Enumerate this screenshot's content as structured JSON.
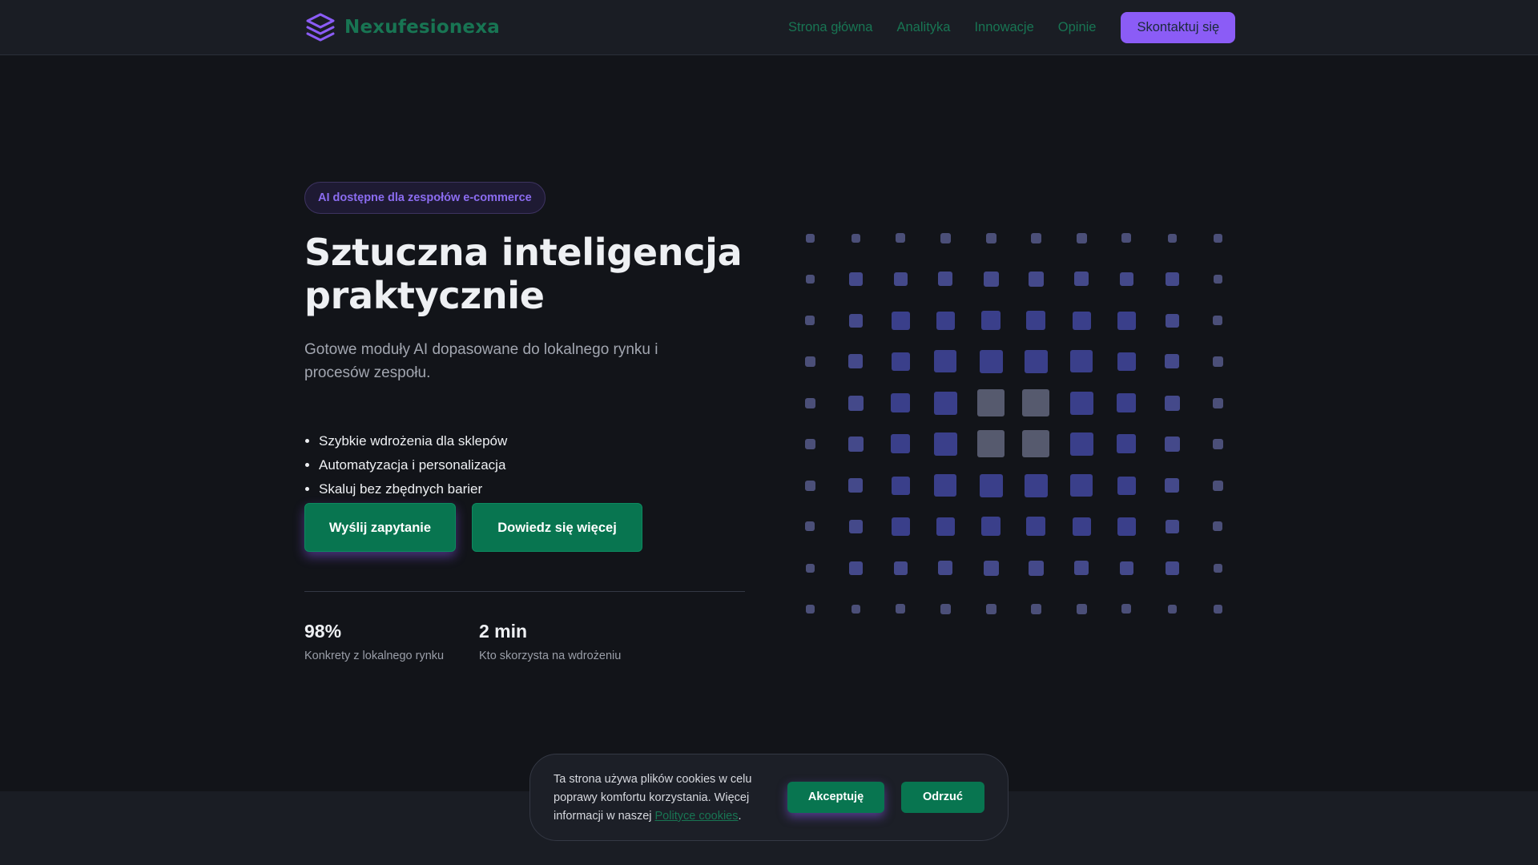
{
  "header": {
    "brand": "Nexufesionexa",
    "logo_icon": "layers-icon",
    "nav": [
      {
        "label": "Strona główna"
      },
      {
        "label": "Analityka"
      },
      {
        "label": "Innowacje"
      },
      {
        "label": "Opinie"
      }
    ],
    "cta_label": "Skontaktuj się"
  },
  "hero": {
    "badge": "AI dostępne dla zespołów e-commerce",
    "title": "Sztuczna inteligencja praktycznie",
    "subtitle": "Gotowe moduły AI dopasowane do lokalnego rynku i procesów zespołu.",
    "features": [
      "Szybkie wdrożenia dla sklepów",
      "Automatyzacja i personalizacja",
      "Skaluj bez zbędnych barier"
    ],
    "primary_button": "Wyślij zapytanie",
    "secondary_button": "Dowiedz się więcej",
    "stats": [
      {
        "value": "98%",
        "label": "Konkrety z lokalnego rynku"
      },
      {
        "value": "2 min",
        "label": "Kto skorzysta na wdrożeniu"
      }
    ]
  },
  "cookie": {
    "text": "Ta strona używa plików cookies w celu poprawy komfortu korzystania. Więcej informacji w naszej ",
    "link": "Polityce cookies",
    "suffix": ".",
    "accept": "Akceptuję",
    "reject": "Odrzuć"
  },
  "colors": {
    "background": "#121419",
    "surface": "#1a1d24",
    "brand_green": "#187553",
    "button_green": "#087550",
    "accent_purple": "#8b5cf6",
    "grid_indigo": "#3a3f8a",
    "grid_grey": "#565a6e"
  }
}
